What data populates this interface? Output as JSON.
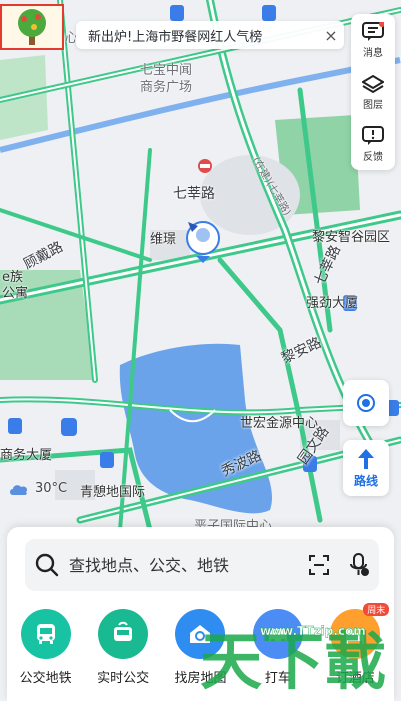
{
  "banner": {
    "text": "新出炉!上海市野餐网红人气榜",
    "close": "×"
  },
  "tools": [
    {
      "icon": "message-icon",
      "label": "消息"
    },
    {
      "icon": "layers-icon",
      "label": "图层"
    },
    {
      "icon": "feedback-icon",
      "label": "反馈"
    }
  ],
  "route": {
    "label": "路线"
  },
  "weather": {
    "icon": "cloud-icon",
    "temp": "30°C"
  },
  "map": {
    "pois": {
      "plaza": "七宝中闻\n商务广场",
      "metro": "七莘路",
      "weipu": "维璟",
      "liyuan": "黎安智谷园区",
      "qiangjin": "强劲大厦",
      "shihong": "世宏金源中心",
      "shangwu": "商务大厦",
      "jingxiu": "青憩地国际",
      "apartment": "e族\n公寓",
      "partial_left": "中心",
      "partial_bottom": "恶子国际中心"
    },
    "roads": {
      "gudai": "顾戴路",
      "qixin": "七莘路",
      "lian": "黎安路",
      "xiubo": "秀波路",
      "yuanwen": "园文路",
      "inner": "(在建)(七莘路)"
    }
  },
  "search": {
    "placeholder": "查找地点、公交、地铁"
  },
  "quick": [
    {
      "icon": "bus-icon",
      "label": "公交地铁",
      "color": "#18c3a3"
    },
    {
      "icon": "realtime-bus-icon",
      "label": "实时公交",
      "color": "#19b992"
    },
    {
      "icon": "house-search-icon",
      "label": "找房地图",
      "color": "#2f8cf0"
    },
    {
      "icon": "taxi-icon",
      "label": "打车",
      "color": "#4b8df5"
    },
    {
      "icon": "hotel-icon",
      "label": "订酒店",
      "color": "#ff9f2e",
      "badge": "周末"
    }
  ],
  "watermark": {
    "big": "天下載",
    "url": "www.TTzip.com"
  },
  "colors": {
    "road": "#3ec98a",
    "water": "#6aa3ea",
    "green": "#8fd3a6",
    "accent": "#1f6fe5"
  }
}
